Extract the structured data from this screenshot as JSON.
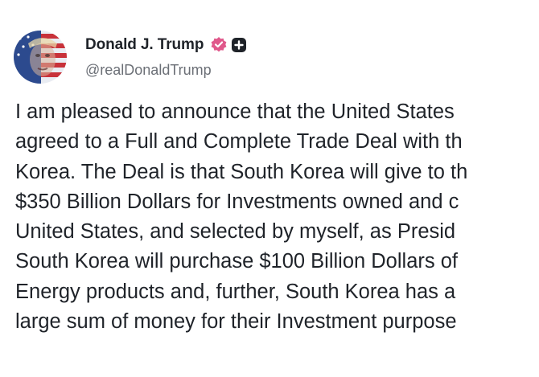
{
  "post": {
    "author": {
      "display_name": "Donald J. Trump",
      "handle": "@realDonaldTrump",
      "avatar_icon": "avatar-flag-portrait",
      "verified_icon": "verified-badge-icon",
      "verified_color": "#e0588b",
      "plus_icon": "plus-badge-icon"
    },
    "lines": [
      "I am pleased to announce that the United States",
      "agreed to a Full and Complete Trade Deal with th",
      "Korea. The Deal is that South Korea will give to th",
      "$350 Billion Dollars for Investments owned and c",
      "United States, and selected by myself, as Presid",
      "South Korea will purchase $100 Billion Dollars of",
      "Energy products and, further, South Korea has a",
      "large sum of money for their Investment purpose"
    ]
  }
}
